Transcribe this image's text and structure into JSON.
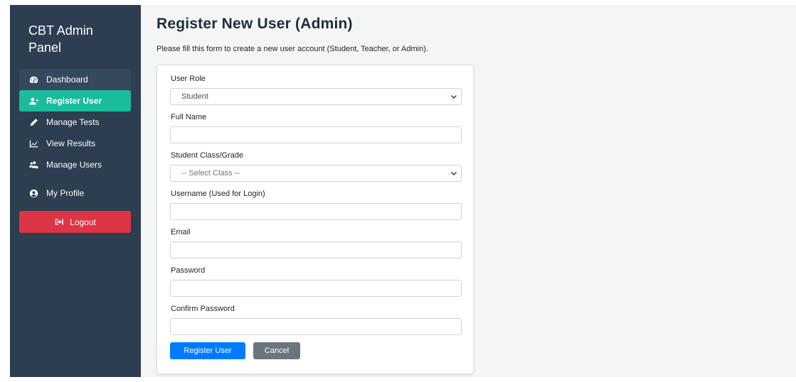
{
  "sidebar": {
    "brand": "CBT Admin Panel",
    "items": [
      {
        "label": "Dashboard",
        "icon": "dashboard-icon"
      },
      {
        "label": "Register User",
        "icon": "user-plus-icon",
        "active": true
      },
      {
        "label": "Manage Tests",
        "icon": "pencil-icon"
      },
      {
        "label": "View Results",
        "icon": "chart-line-icon"
      },
      {
        "label": "Manage Users",
        "icon": "users-cog-icon"
      },
      {
        "label": "My Profile",
        "icon": "user-circle-icon"
      },
      {
        "label": "Logout",
        "icon": "sign-out-icon"
      }
    ]
  },
  "main": {
    "title": "Register New User (Admin)",
    "subtitle": "Please fill this form to create a new user account (Student, Teacher, or Admin).",
    "form": {
      "role_label": "User Role",
      "role_value": "Student",
      "fullname_label": "Full Name",
      "fullname_value": "",
      "class_label": "Student Class/Grade",
      "class_value": "-- Select Class --",
      "username_label": "Username (Used for Login)",
      "username_value": "",
      "email_label": "Email",
      "email_value": "",
      "password_label": "Password",
      "password_value": "",
      "confirm_label": "Confirm Password",
      "confirm_value": "",
      "submit_label": "Register User",
      "cancel_label": "Cancel"
    }
  },
  "colors": {
    "sidebar_bg": "#2c3e50",
    "active_bg": "#1abc9c",
    "logout_bg": "#dc3545",
    "primary": "#007bff",
    "secondary": "#6c757d"
  }
}
